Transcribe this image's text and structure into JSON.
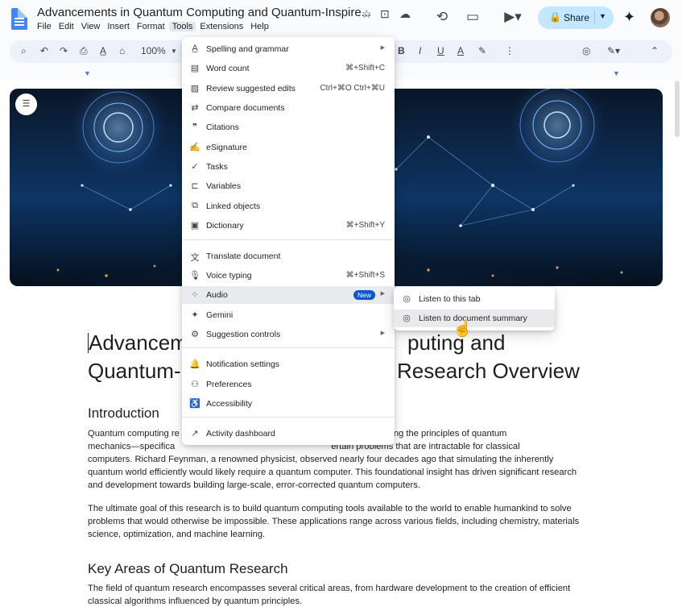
{
  "doc_title": "Advancements in Quantum Computing and Quantum-Inspire...",
  "menubar": [
    "File",
    "Edit",
    "View",
    "Insert",
    "Format",
    "Tools",
    "Extensions",
    "Help"
  ],
  "share_label": "Share",
  "zoom": "100%",
  "tools_menu": {
    "items": [
      {
        "icon": "spellcheck-icon",
        "glyph": "A̲",
        "label": "Spelling and grammar",
        "shortcut": "",
        "submenu": true
      },
      {
        "icon": "word-count-icon",
        "glyph": "▤",
        "label": "Word count",
        "shortcut": "⌘+Shift+C",
        "submenu": false
      },
      {
        "icon": "review-edits-icon",
        "glyph": "▨",
        "label": "Review suggested edits",
        "shortcut": "Ctrl+⌘O Ctrl+⌘U",
        "submenu": false
      },
      {
        "icon": "compare-icon",
        "glyph": "⇄",
        "label": "Compare documents",
        "shortcut": "",
        "submenu": false
      },
      {
        "icon": "citations-icon",
        "glyph": "❞",
        "label": "Citations",
        "shortcut": "",
        "submenu": false
      },
      {
        "icon": "esignature-icon",
        "glyph": "✍",
        "label": "eSignature",
        "shortcut": "",
        "submenu": false
      },
      {
        "icon": "tasks-icon",
        "glyph": "✓",
        "label": "Tasks",
        "shortcut": "",
        "submenu": false
      },
      {
        "icon": "variables-icon",
        "glyph": "⊏",
        "label": "Variables",
        "shortcut": "",
        "submenu": false
      },
      {
        "icon": "linked-objects-icon",
        "glyph": "⧉",
        "label": "Linked objects",
        "shortcut": "",
        "submenu": false
      },
      {
        "icon": "dictionary-icon",
        "glyph": "▣",
        "label": "Dictionary",
        "shortcut": "⌘+Shift+Y",
        "submenu": false
      },
      {
        "icon": "translate-icon",
        "glyph": "文",
        "label": "Translate document",
        "shortcut": "",
        "submenu": false
      },
      {
        "icon": "microphone-icon",
        "glyph": "🎙",
        "label": "Voice typing",
        "shortcut": "⌘+Shift+S",
        "submenu": false
      },
      {
        "icon": "audio-icon",
        "glyph": "⁘",
        "label": "Audio",
        "shortcut": "",
        "submenu": true,
        "badge": "New"
      },
      {
        "icon": "gemini-icon",
        "glyph": "✦",
        "label": "Gemini",
        "shortcut": "",
        "submenu": false
      },
      {
        "icon": "suggestion-controls-icon",
        "glyph": "⚙",
        "label": "Suggestion controls",
        "shortcut": "",
        "submenu": true
      },
      {
        "icon": "bell-icon",
        "glyph": "🔔",
        "label": "Notification settings",
        "shortcut": "",
        "submenu": false
      },
      {
        "icon": "preferences-icon",
        "glyph": "⚇",
        "label": "Preferences",
        "shortcut": "",
        "submenu": false
      },
      {
        "icon": "accessibility-icon",
        "glyph": "♿",
        "label": "Accessibility",
        "shortcut": "",
        "submenu": false
      },
      {
        "icon": "activity-dashboard-icon",
        "glyph": "↗",
        "label": "Activity dashboard",
        "shortcut": "",
        "submenu": false
      }
    ]
  },
  "audio_submenu": {
    "items": [
      {
        "icon": "listen-icon",
        "glyph": "◎",
        "label": "Listen to this tab"
      },
      {
        "icon": "listen-summary-icon",
        "glyph": "◎",
        "label": "Listen to document summary"
      }
    ]
  },
  "document": {
    "h1_left_1": "Advancem",
    "h1_right_1": "puting and",
    "h1_left_2": "Quantum-",
    "h1_right_2": "Research Overview",
    "h2_intro": "Introduction",
    "p1": {
      "l1a": "Quantum computing re",
      "l1b": "ng the principles of quantum",
      "l2a": "mechanics—specifica",
      "l2b": "ertain problems that are intractable for classical",
      "l3": "computers. Richard Feynman, a renowned physicist, observed nearly four decades ago that simulating the inherently",
      "l4": "quantum world efficiently would likely require a quantum computer. This foundational insight has driven significant research",
      "l5": "and development towards building large-scale, error-corrected quantum computers."
    },
    "p2": {
      "l1": "The ultimate goal of this research is to build quantum computing tools available to the world to enable humankind to solve",
      "l2": "problems that would otherwise be impossible. These applications range across various fields, including chemistry, materials",
      "l3": "science, optimization, and machine learning."
    },
    "h2_key": "Key Areas of Quantum Research",
    "p3": {
      "l1": "The field of quantum research encompasses several critical areas, from hardware development to the creation of efficient",
      "l2": "classical algorithms influenced by quantum principles."
    }
  },
  "colors": {
    "accent": "#0b57d0",
    "share_bg": "#c2e7ff",
    "toolbar_bg": "#edf2fa"
  }
}
